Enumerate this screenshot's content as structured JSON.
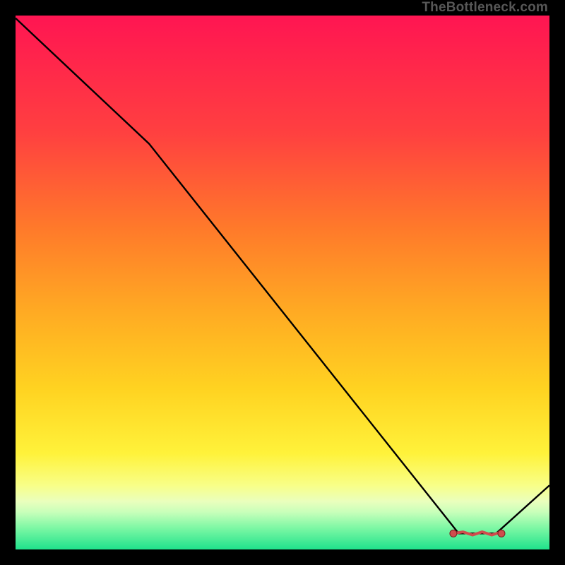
{
  "watermark": "TheBottleneck.com",
  "chart_data": {
    "type": "line",
    "title": "",
    "xlabel": "",
    "ylabel": "",
    "xlim": [
      0,
      100
    ],
    "ylim": [
      0,
      100
    ],
    "x": [
      0,
      25,
      83,
      90,
      100
    ],
    "values": [
      99.5,
      76,
      3,
      3,
      12
    ],
    "marker_segment": {
      "x_from": 82,
      "x_to": 91,
      "y_from": 3.0,
      "y_to": 3.0
    },
    "gradient_stops": [
      {
        "offset": 0,
        "color": "#ff1552"
      },
      {
        "offset": 22,
        "color": "#ff4040"
      },
      {
        "offset": 40,
        "color": "#ff7a2a"
      },
      {
        "offset": 55,
        "color": "#ffa923"
      },
      {
        "offset": 70,
        "color": "#ffd321"
      },
      {
        "offset": 82,
        "color": "#fff23a"
      },
      {
        "offset": 88,
        "color": "#f8ff88"
      },
      {
        "offset": 91,
        "color": "#eaffbd"
      },
      {
        "offset": 93,
        "color": "#c8ffba"
      },
      {
        "offset": 96,
        "color": "#7cf7a4"
      },
      {
        "offset": 100,
        "color": "#1fe28c"
      }
    ],
    "line_color": "#000000",
    "marker_color": "#cf4d4d",
    "marker_stroke": "#7a1f1f"
  }
}
